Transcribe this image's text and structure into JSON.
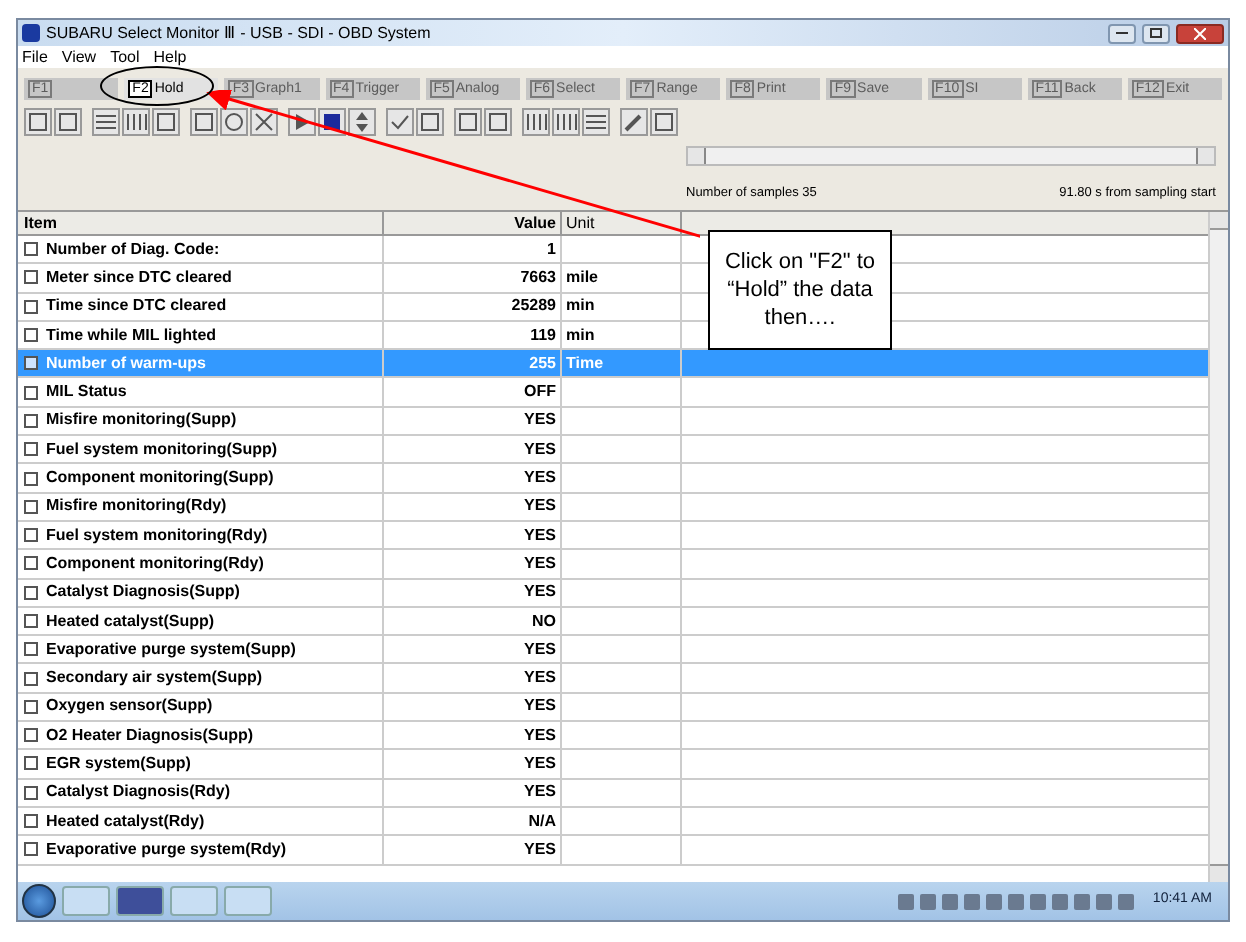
{
  "window": {
    "title": "SUBARU Select Monitor Ⅲ - USB - SDI - OBD System"
  },
  "menu": [
    "File",
    "View",
    "Tool",
    "Help"
  ],
  "function_keys": [
    {
      "key": "F1",
      "disabled": true
    },
    {
      "key": "F2",
      "label": "Hold",
      "disabled": false
    },
    {
      "key": "F3",
      "label": "Graph1",
      "disabled": true
    },
    {
      "key": "F4",
      "label": "Trigger",
      "disabled": true
    },
    {
      "key": "F5",
      "label": "Analog",
      "disabled": true
    },
    {
      "key": "F6",
      "label": "Select",
      "disabled": true
    },
    {
      "key": "F7",
      "label": "Range",
      "disabled": true
    },
    {
      "key": "F8",
      "label": "Print",
      "disabled": true
    },
    {
      "key": "F9",
      "label": "Save",
      "disabled": true
    },
    {
      "key": "F10",
      "label": "SI",
      "disabled": true
    },
    {
      "key": "F11",
      "label": "Back",
      "disabled": true
    },
    {
      "key": "F12",
      "label": "Exit",
      "disabled": true
    }
  ],
  "sampling": {
    "samples": "Number of samples 35",
    "elapsed": "91.80 s from sampling start"
  },
  "table": {
    "columns": [
      "Item",
      "Value",
      "Unit"
    ],
    "rows": [
      {
        "item": "Number of Diag. Code:",
        "value": "1",
        "unit": "",
        "checked": false,
        "selected": false
      },
      {
        "item": "Meter since DTC cleared",
        "value": "7663",
        "unit": "mile",
        "checked": false,
        "selected": false
      },
      {
        "item": "Time since DTC cleared",
        "value": "25289",
        "unit": "min",
        "checked": false,
        "selected": false
      },
      {
        "item": "Time while MIL lighted",
        "value": "119",
        "unit": "min",
        "checked": false,
        "selected": false
      },
      {
        "item": "Number of warm-ups",
        "value": "255",
        "unit": "Time",
        "checked": false,
        "selected": true
      },
      {
        "item": "MIL Status",
        "value": "OFF",
        "unit": "",
        "checked": false,
        "selected": false
      },
      {
        "item": "Misfire monitoring(Supp)",
        "value": "YES",
        "unit": "",
        "checked": false,
        "selected": false
      },
      {
        "item": "Fuel system monitoring(Supp)",
        "value": "YES",
        "unit": "",
        "checked": false,
        "selected": false
      },
      {
        "item": "Component monitoring(Supp)",
        "value": "YES",
        "unit": "",
        "checked": false,
        "selected": false
      },
      {
        "item": "Misfire monitoring(Rdy)",
        "value": "YES",
        "unit": "",
        "checked": false,
        "selected": false
      },
      {
        "item": "Fuel system monitoring(Rdy)",
        "value": "YES",
        "unit": "",
        "checked": false,
        "selected": false
      },
      {
        "item": "Component monitoring(Rdy)",
        "value": "YES",
        "unit": "",
        "checked": false,
        "selected": false
      },
      {
        "item": "Catalyst Diagnosis(Supp)",
        "value": "YES",
        "unit": "",
        "checked": false,
        "selected": false
      },
      {
        "item": "Heated catalyst(Supp)",
        "value": "NO",
        "unit": "",
        "checked": false,
        "selected": false
      },
      {
        "item": "Evaporative purge system(Supp)",
        "value": "YES",
        "unit": "",
        "checked": false,
        "selected": false
      },
      {
        "item": "Secondary air system(Supp)",
        "value": "YES",
        "unit": "",
        "checked": false,
        "selected": false
      },
      {
        "item": "Oxygen sensor(Supp)",
        "value": "YES",
        "unit": "",
        "checked": false,
        "selected": false
      },
      {
        "item": "O2 Heater Diagnosis(Supp)",
        "value": "YES",
        "unit": "",
        "checked": false,
        "selected": false
      },
      {
        "item": "EGR system(Supp)",
        "value": "YES",
        "unit": "",
        "checked": false,
        "selected": false
      },
      {
        "item": "Catalyst Diagnosis(Rdy)",
        "value": "YES",
        "unit": "",
        "checked": false,
        "selected": false
      },
      {
        "item": "Heated catalyst(Rdy)",
        "value": "N/A",
        "unit": "",
        "checked": false,
        "selected": false
      },
      {
        "item": "Evaporative purge system(Rdy)",
        "value": "YES",
        "unit": "",
        "checked": false,
        "selected": false
      }
    ]
  },
  "callout": {
    "text": "Click on \"F2\" to “Hold” the data then…."
  },
  "taskbar": {
    "clock": "10:41 AM"
  }
}
